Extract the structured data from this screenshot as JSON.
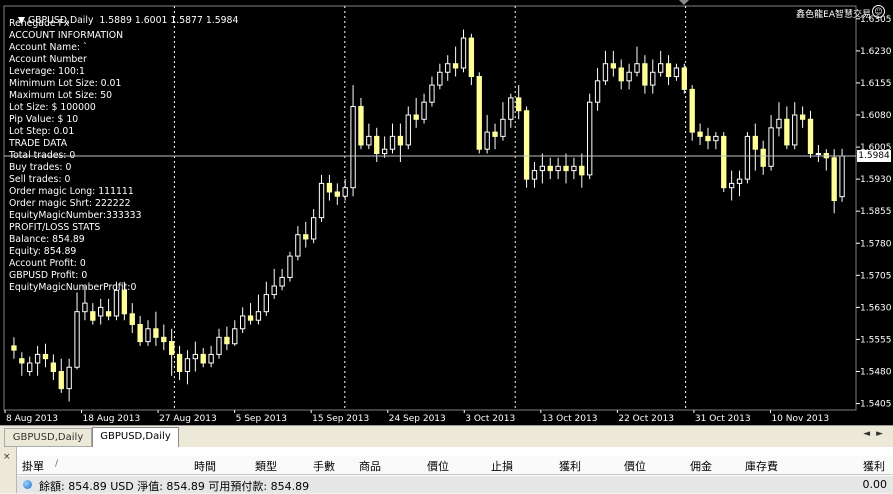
{
  "chart": {
    "title": "GBPUSD,Daily  1.5889 1.6001 1.5877 1.5984",
    "info_lines": [
      "Renegade Fx",
      "ACCOUNT INFORMATION",
      "Account Name: `",
      "Account Number",
      "Leverage: 100:1",
      "Mimimum Lot Size: 0.01",
      "Maximum Lot Size: 50",
      "Lot Size: $ 100000",
      "Pip Value: $ 10",
      "Lot Step: 0.01",
      "TRADE DATA",
      "Total trades: 0",
      "Buy trades: 0",
      "Sell trades: 0",
      "Order magic Long: 111111",
      "Order magic Shrt: 222222",
      "EquityMagicNumber:333333",
      "PROFIT/LOSS STATS",
      "Balance: 854.89",
      "Equity: 854.89",
      "Account Profit: 0",
      "GBPUSD Profit: 0",
      "EquityMagicNumberProfit:0"
    ],
    "ea_label": "鑫色龍EA智慧交易",
    "ea_icon": "smiley-icon",
    "current_price": "1.5984",
    "colors": {
      "background": "#000000",
      "bull": "#ffff99",
      "bear": "#ffff99",
      "text": "#ffffff",
      "grid": "#ffffff"
    }
  },
  "chart_data": {
    "type": "candlestick",
    "y_ticks": [
      1.6305,
      1.623,
      1.6155,
      1.608,
      1.6005,
      1.593,
      1.5855,
      1.578,
      1.5705,
      1.563,
      1.5555,
      1.548,
      1.5405
    ],
    "ylim": [
      1.539,
      1.6335
    ],
    "x_labels": [
      "8 Aug 2013",
      "18 Aug 2013",
      "27 Aug 2013",
      "5 Sep 2013",
      "15 Sep 2013",
      "24 Sep 2013",
      "3 Oct 2013",
      "13 Oct 2013",
      "22 Oct 2013",
      "31 Oct 2013",
      "10 Nov 2013"
    ],
    "candles": [
      [
        1.554,
        1.553,
        1.556,
        1.551
      ],
      [
        1.551,
        1.55,
        1.5525,
        1.547
      ],
      [
        1.548,
        1.55,
        1.5515,
        1.547
      ],
      [
        1.55,
        1.552,
        1.554,
        1.547
      ],
      [
        1.552,
        1.551,
        1.5545,
        1.549
      ],
      [
        1.55,
        1.548,
        1.552,
        1.546
      ],
      [
        1.548,
        1.544,
        1.551,
        1.543
      ],
      [
        1.544,
        1.549,
        1.551,
        1.541
      ],
      [
        1.549,
        1.562,
        1.5665,
        1.5485
      ],
      [
        1.562,
        1.564,
        1.568,
        1.56
      ],
      [
        1.562,
        1.56,
        1.564,
        1.559
      ],
      [
        1.561,
        1.563,
        1.565,
        1.559
      ],
      [
        1.562,
        1.561,
        1.565,
        1.56
      ],
      [
        1.561,
        1.567,
        1.569,
        1.56
      ],
      [
        1.567,
        1.5615,
        1.569,
        1.56
      ],
      [
        1.5615,
        1.559,
        1.564,
        1.557
      ],
      [
        1.559,
        1.555,
        1.561,
        1.554
      ],
      [
        1.555,
        1.558,
        1.56,
        1.554
      ],
      [
        1.558,
        1.556,
        1.562,
        1.554
      ],
      [
        1.556,
        1.555,
        1.559,
        1.553
      ],
      [
        1.555,
        1.552,
        1.558,
        1.547
      ],
      [
        1.552,
        1.548,
        1.554,
        1.546
      ],
      [
        1.548,
        1.551,
        1.553,
        1.545
      ],
      [
        1.551,
        1.552,
        1.555,
        1.548
      ],
      [
        1.552,
        1.55,
        1.5535,
        1.549
      ],
      [
        1.55,
        1.552,
        1.554,
        1.549
      ],
      [
        1.552,
        1.556,
        1.558,
        1.551
      ],
      [
        1.556,
        1.5545,
        1.5585,
        1.553
      ],
      [
        1.5545,
        1.558,
        1.56,
        1.554
      ],
      [
        1.558,
        1.561,
        1.563,
        1.557
      ],
      [
        1.561,
        1.56,
        1.564,
        1.559
      ],
      [
        1.56,
        1.562,
        1.566,
        1.559
      ],
      [
        1.562,
        1.566,
        1.569,
        1.561
      ],
      [
        1.566,
        1.568,
        1.572,
        1.565
      ],
      [
        1.568,
        1.57,
        1.572,
        1.567
      ],
      [
        1.57,
        1.575,
        1.576,
        1.569
      ],
      [
        1.575,
        1.58,
        1.582,
        1.574
      ],
      [
        1.58,
        1.579,
        1.583,
        1.577
      ],
      [
        1.579,
        1.584,
        1.586,
        1.578
      ],
      [
        1.584,
        1.592,
        1.594,
        1.583
      ],
      [
        1.592,
        1.59,
        1.594,
        1.588
      ],
      [
        1.59,
        1.589,
        1.592,
        1.587
      ],
      [
        1.589,
        1.591,
        1.593,
        1.588
      ],
      [
        1.591,
        1.61,
        1.615,
        1.589
      ],
      [
        1.61,
        1.601,
        1.612,
        1.6
      ],
      [
        1.601,
        1.603,
        1.606,
        1.6
      ],
      [
        1.603,
        1.599,
        1.605,
        1.597
      ],
      [
        1.599,
        1.6,
        1.603,
        1.598
      ],
      [
        1.6,
        1.603,
        1.606,
        1.599
      ],
      [
        1.603,
        1.601,
        1.606,
        1.597
      ],
      [
        1.601,
        1.608,
        1.61,
        1.6
      ],
      [
        1.608,
        1.607,
        1.612,
        1.605
      ],
      [
        1.607,
        1.611,
        1.613,
        1.606
      ],
      [
        1.611,
        1.615,
        1.617,
        1.61
      ],
      [
        1.615,
        1.618,
        1.62,
        1.614
      ],
      [
        1.618,
        1.62,
        1.622,
        1.616
      ],
      [
        1.62,
        1.619,
        1.624,
        1.617
      ],
      [
        1.619,
        1.626,
        1.628,
        1.618
      ],
      [
        1.626,
        1.617,
        1.627,
        1.615
      ],
      [
        1.617,
        1.6,
        1.618,
        1.599
      ],
      [
        1.6,
        1.604,
        1.608,
        1.599
      ],
      [
        1.604,
        1.603,
        1.606,
        1.6
      ],
      [
        1.603,
        1.607,
        1.611,
        1.602
      ],
      [
        1.607,
        1.612,
        1.613,
        1.605
      ],
      [
        1.612,
        1.609,
        1.615,
        1.607
      ],
      [
        1.609,
        1.593,
        1.61,
        1.591
      ],
      [
        1.593,
        1.595,
        1.597,
        1.591
      ],
      [
        1.595,
        1.596,
        1.599,
        1.592
      ],
      [
        1.596,
        1.595,
        1.598,
        1.593
      ],
      [
        1.595,
        1.596,
        1.598,
        1.593
      ],
      [
        1.596,
        1.595,
        1.599,
        1.592
      ],
      [
        1.595,
        1.596,
        1.598,
        1.593
      ],
      [
        1.596,
        1.594,
        1.599,
        1.591
      ],
      [
        1.594,
        1.611,
        1.613,
        1.593
      ],
      [
        1.611,
        1.616,
        1.619,
        1.609
      ],
      [
        1.616,
        1.62,
        1.623,
        1.615
      ],
      [
        1.62,
        1.619,
        1.623,
        1.617
      ],
      [
        1.619,
        1.616,
        1.621,
        1.614
      ],
      [
        1.616,
        1.618,
        1.62,
        1.614
      ],
      [
        1.618,
        1.62,
        1.624,
        1.617
      ],
      [
        1.62,
        1.615,
        1.622,
        1.613
      ],
      [
        1.615,
        1.618,
        1.621,
        1.613
      ],
      [
        1.618,
        1.62,
        1.623,
        1.617
      ],
      [
        1.62,
        1.617,
        1.622,
        1.615
      ],
      [
        1.617,
        1.619,
        1.62,
        1.616
      ],
      [
        1.619,
        1.614,
        1.62,
        1.613
      ],
      [
        1.614,
        1.604,
        1.615,
        1.602
      ],
      [
        1.604,
        1.603,
        1.606,
        1.601
      ],
      [
        1.603,
        1.602,
        1.605,
        1.6
      ],
      [
        1.602,
        1.603,
        1.604,
        1.6
      ],
      [
        1.603,
        1.591,
        1.604,
        1.59
      ],
      [
        1.591,
        1.592,
        1.595,
        1.588
      ],
      [
        1.592,
        1.593,
        1.595,
        1.589
      ],
      [
        1.593,
        1.603,
        1.604,
        1.592
      ],
      [
        1.603,
        1.6,
        1.606,
        1.595
      ],
      [
        1.6,
        1.596,
        1.602,
        1.594
      ],
      [
        1.596,
        1.605,
        1.608,
        1.595
      ],
      [
        1.605,
        1.607,
        1.611,
        1.603
      ],
      [
        1.607,
        1.601,
        1.61,
        1.6
      ],
      [
        1.601,
        1.608,
        1.611,
        1.6
      ],
      [
        1.608,
        1.607,
        1.61,
        1.605
      ],
      [
        1.607,
        1.599,
        1.609,
        1.598
      ],
      [
        1.599,
        1.599,
        1.601,
        1.597
      ],
      [
        1.599,
        1.598,
        1.6,
        1.595
      ],
      [
        1.598,
        1.588,
        1.6,
        1.585
      ],
      [
        1.5889,
        1.5984,
        1.6001,
        1.5877
      ]
    ]
  },
  "tabs": [
    "GBPUSD,Daily",
    "GBPUSD,Daily"
  ],
  "terminal": {
    "columns": [
      "掛單",
      "時間",
      "類型",
      "手數",
      "商品",
      "價位",
      "止損",
      "獲利",
      "價位",
      "佣金",
      "庫存費",
      "獲利"
    ],
    "sort_indicator": "/",
    "balance_text": "餘額: 854.89 USD  淨值: 854.89  可用預付款: 854.89",
    "balance_value": "0.00",
    "close_glyph": "×"
  }
}
